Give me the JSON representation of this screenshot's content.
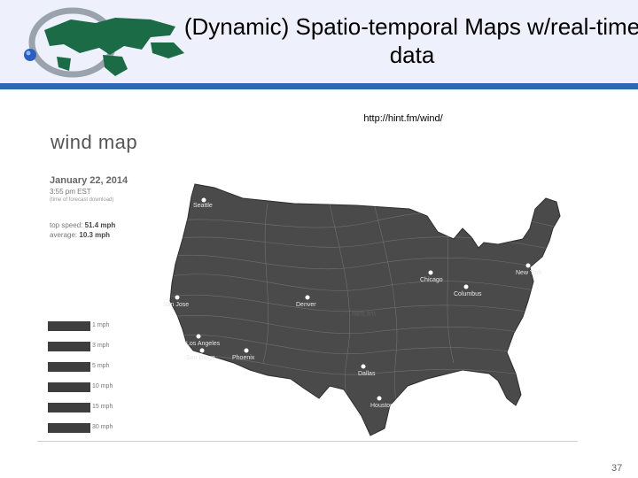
{
  "slide": {
    "title": "(Dynamic) Spatio-temporal Maps w/real-time data",
    "url": "http://hint.fm/wind/",
    "page_number": "37"
  },
  "colors": {
    "header_bg": "#eef0fb",
    "header_bar": "#2e68b4",
    "map_fill": "#4a4a4a"
  },
  "wind_map": {
    "title": "wind map",
    "date": "January 22, 2014",
    "time": "3:55 pm EST",
    "subtitle": "(time of forecast download)",
    "top_speed_label": "top speed:",
    "top_speed": "51.4 mph",
    "average_label": "average:",
    "average": "10.3 mph",
    "watermark": "hint.fm",
    "legend": [
      "1 mph",
      "3 mph",
      "5 mph",
      "10 mph",
      "15 mph",
      "30 mph"
    ],
    "cities": [
      "Seattle",
      "San Jose",
      "Los Angeles",
      "San Diego",
      "Phoenix",
      "Denver",
      "Dallas",
      "Houston",
      "Chicago",
      "Columbus",
      "New York"
    ]
  }
}
